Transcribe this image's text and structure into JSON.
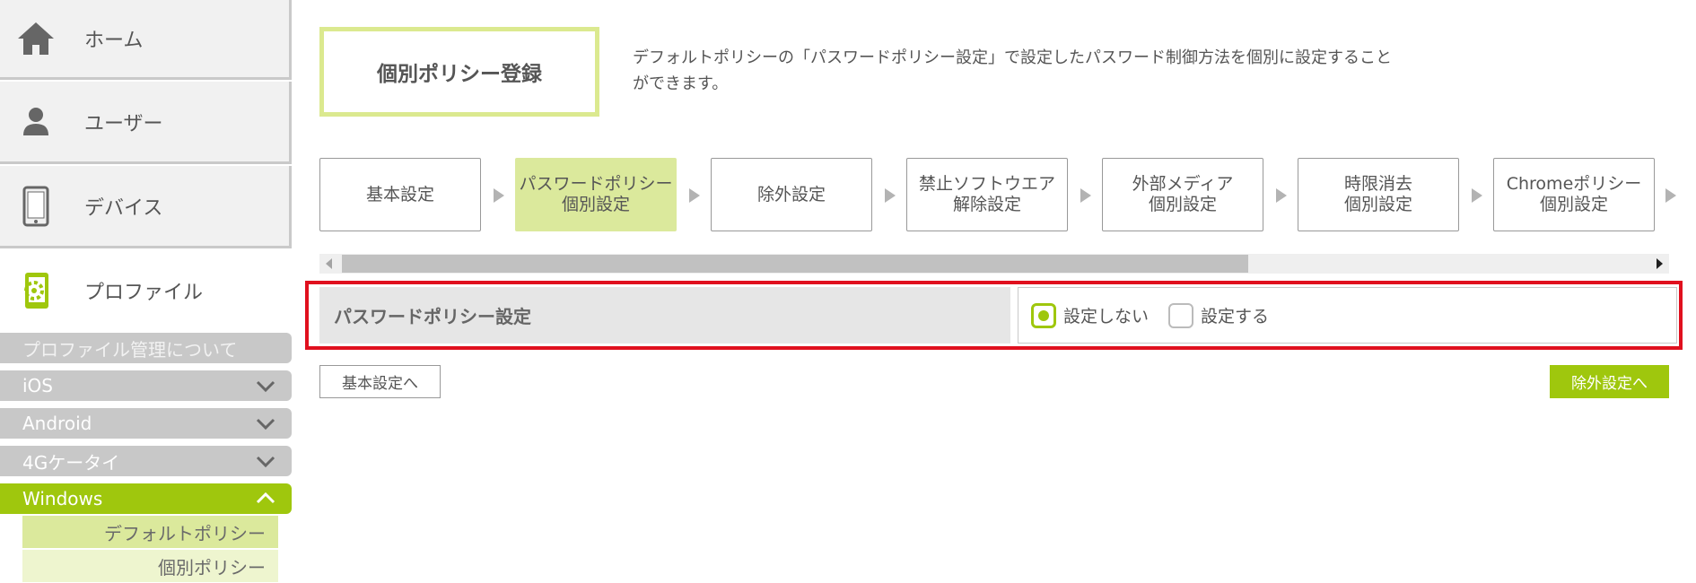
{
  "sidebar": {
    "home_label": "ホーム",
    "user_label": "ユーザー",
    "device_label": "デバイス",
    "profile_label": "プロファイル",
    "sub_items": {
      "about": "プロファイル管理について",
      "ios": "iOS",
      "android": "Android",
      "keitai": "4Gケータイ",
      "windows": "Windows"
    },
    "windows_children": {
      "default_policy": "デフォルトポリシー",
      "individual_policy": "個別ポリシー"
    }
  },
  "page": {
    "title": "個別ポリシー登録",
    "description": "デフォルトポリシーの「パスワードポリシー設定」で設定したパスワード制御方法を個別に設定することができます。"
  },
  "steps": {
    "s1": "基本設定",
    "s2a": "パスワードポリシー",
    "s2b": "個別設定",
    "s3": "除外設定",
    "s4a": "禁止ソフトウエア",
    "s4b": "解除設定",
    "s5a": "外部メディア",
    "s5b": "個別設定",
    "s6a": "時限消去",
    "s6b": "個別設定",
    "s7a": "Chromeポリシー",
    "s7b": "個別設定"
  },
  "setting": {
    "label": "パスワードポリシー設定",
    "options": {
      "off": "設定しない",
      "on": "設定する"
    },
    "selected": "設定しない"
  },
  "buttons": {
    "back": "基本設定へ",
    "next": "除外設定へ"
  },
  "colors": {
    "accent": "#9fc70d",
    "step_active": "#dbe99c",
    "highlight_border": "#e0101e"
  }
}
